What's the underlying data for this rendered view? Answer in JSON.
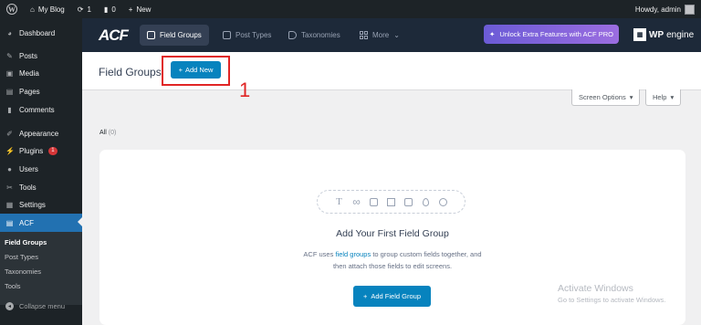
{
  "admin_bar": {
    "site_name": "My Blog",
    "updates_count": "1",
    "comments_count": "0",
    "new_label": "New",
    "greeting": "Howdy, admin"
  },
  "sidebar": {
    "items": [
      {
        "label": "Dashboard",
        "icon": "dashboard-icon"
      },
      {
        "label": "Posts",
        "icon": "pin-icon"
      },
      {
        "label": "Media",
        "icon": "media-icon"
      },
      {
        "label": "Pages",
        "icon": "pages-icon"
      },
      {
        "label": "Comments",
        "icon": "comment-icon"
      },
      {
        "label": "Appearance",
        "icon": "brush-icon"
      },
      {
        "label": "Plugins",
        "icon": "plug-icon",
        "badge": "1"
      },
      {
        "label": "Users",
        "icon": "user-icon"
      },
      {
        "label": "Tools",
        "icon": "wrench-icon"
      },
      {
        "label": "Settings",
        "icon": "settings-icon"
      },
      {
        "label": "ACF",
        "icon": "acf-icon"
      }
    ],
    "submenu": [
      "Field Groups",
      "Post Types",
      "Taxonomies",
      "Tools"
    ],
    "collapse_label": "Collapse menu"
  },
  "acf_nav": {
    "logo": "ACF",
    "tabs": [
      "Field Groups",
      "Post Types",
      "Taxonomies",
      "More"
    ],
    "pro_button": "Unlock Extra Features with ACF PRO",
    "partner_wp": "WP",
    "partner_engine": "engine"
  },
  "page": {
    "title": "Field Groups",
    "add_new": "Add New",
    "step_number": "1",
    "screen_options": "Screen Options",
    "help": "Help",
    "filter_all": "All",
    "filter_all_count": "(0)"
  },
  "empty_state": {
    "title": "Add Your First Field Group",
    "desc_before": "ACF uses",
    "desc_link": "field groups",
    "desc_after": "to group custom fields together, and",
    "desc_line2": "then attach those fields to edit screens.",
    "button": "Add Field Group"
  },
  "watermark": {
    "line1": "Activate Windows",
    "line2": "Go to Settings to activate Windows."
  },
  "colors": {
    "admin_dark": "#1d2327",
    "acf_nav": "#1d2939",
    "accent_blue": "#0783be",
    "wp_blue": "#2271b1",
    "highlight_red": "#e02424"
  }
}
